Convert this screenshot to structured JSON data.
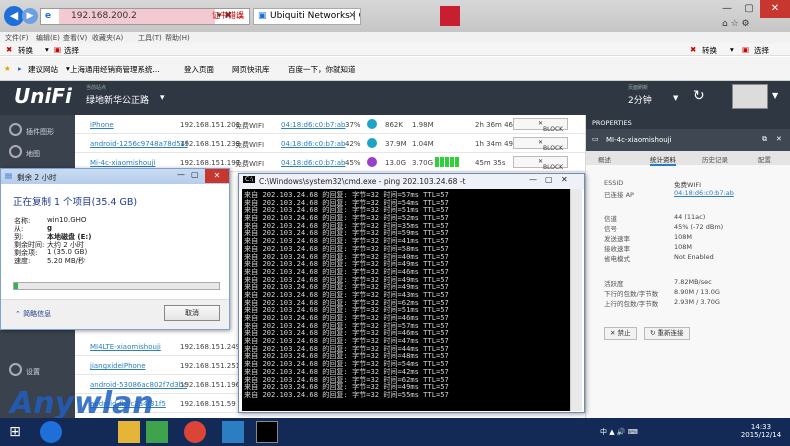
{
  "browser": {
    "address": "192.168.200.2",
    "tab_inactive": "证书错误",
    "tab_active": "Ubiquiti Networks | Clients",
    "menu": [
      "文件(F)",
      "编辑(E)",
      "查看(V)",
      "收藏夹(A)",
      "工具(T)",
      "帮助(H)"
    ],
    "cmd_left": [
      "转换",
      "选择"
    ],
    "cmd_right": [
      "转换",
      "选择"
    ],
    "favorites": [
      "建议网站",
      "上海通用经销商管理系统...",
      "登入页面",
      "网页快讯库",
      "百度一下，你就知道"
    ]
  },
  "unifi": {
    "logo": "UniFi",
    "site_label": "当前站点",
    "site_name": "绿地新华公正路",
    "refresh_label": "页面刷新",
    "refresh_value": "2分钟",
    "nav": [
      "插件图形",
      "地图",
      "设置"
    ]
  },
  "clients": [
    {
      "name": "iPhone",
      "ip": "192.168.151.201",
      "ap": "免费WIFI",
      "mac": "04:18:d6:c0:b7:ab",
      "pct": "37%",
      "down": "862K",
      "up": "1.98M",
      "uptime": "2h 36m 46s",
      "action": "BLOCK"
    },
    {
      "name": "android-1256c9748a78d54f",
      "ip": "192.168.151.239",
      "ap": "免费WIFI",
      "mac": "04:18:d6:c0:b7:ab",
      "pct": "42%",
      "down": "37.9M",
      "up": "1.04M",
      "uptime": "1h 34m 49s",
      "action": "BLOCK"
    },
    {
      "name": "Mi-4c-xiaomishouji",
      "ip": "192.168.151.197",
      "ap": "免费WIFI",
      "mac": "04:18:d6:c0:b7:ab",
      "pct": "45%",
      "down": "13.0G",
      "up": "3.70G",
      "uptime": "45m 35s",
      "action": "BLOCK"
    }
  ],
  "clients_lower": [
    {
      "name": "MI4LTE-xiaomishouji",
      "ip": "192.168.151.249"
    },
    {
      "name": "jiangxideiPhone",
      "ip": "192.168.151.251"
    },
    {
      "name": "android-53086ac802f7d3bc",
      "ip": "192.168.151.196"
    },
    {
      "name": "android-fb0c2a4f31f5",
      "ip": "192.168.151.59"
    }
  ],
  "properties": {
    "panel_title": "PROPERTIES",
    "device": "MI-4c-xiaomishouji",
    "tabs": [
      "概述",
      "统计资料",
      "历史记录",
      "配置"
    ],
    "essid_label": "ESSID",
    "essid": "免费WIFI",
    "ap_label": "已连接 AP",
    "ap": "04:18:d6:c0:b7:ab",
    "channel_label": "信道",
    "channel": "44 (11ac)",
    "signal_label": "信号",
    "signal": "45% (-72 dBm)",
    "tx_label": "发送速率",
    "tx": "108M",
    "rx_label": "接收速率",
    "rx": "108M",
    "power_label": "省电模式",
    "power": "Not Enabled",
    "activity_label": "活跃度",
    "activity": "7.82MB/sec",
    "dl_label": "下行的包数/字节数",
    "dl": "8.90M / 13.0G",
    "ul_label": "上行的包数/字节数",
    "ul": "2.93M / 3.70G",
    "btn_block": "禁止",
    "btn_reconnect": "重新连接"
  },
  "copy_dialog": {
    "titlebar": "剩余 2 小时",
    "heading": "正在复制 1 个项目(35.4 GB)",
    "name_label": "名称:",
    "name": "win10.GHO",
    "from_label": "从:",
    "from": "g",
    "to_label": "到:",
    "to": "本地磁盘 (E:)",
    "remain_time_label": "剩余时间:",
    "remain_time": "大约 2 小时",
    "remain_items_label": "剩余项:",
    "remain_items": "1 (35.0 GB)",
    "speed_label": "速度:",
    "speed": "5.20 MB/秒",
    "progress": 0.02,
    "less_info": "简略信息",
    "cancel": "取消"
  },
  "cmd": {
    "title": "C:\\Windows\\system32\\cmd.exe - ping  202.103.24.68 -t",
    "lines": [
      "来自 202.103.24.68 的回复: 字节=32 时间=57ms TTL=57",
      "来自 202.103.24.68 的回复: 字节=32 时间=54ms TTL=57",
      "来自 202.103.24.68 的回复: 字节=32 时间=51ms TTL=57",
      "来自 202.103.24.68 的回复: 字节=32 时间=52ms TTL=57",
      "来自 202.103.24.68 的回复: 字节=32 时间=35ms TTL=57",
      "来自 202.103.24.68 的回复: 字节=32 时间=59ms TTL=57",
      "来自 202.103.24.68 的回复: 字节=32 时间=41ms TTL=57",
      "来自 202.103.24.68 的回复: 字节=32 时间=58ms TTL=57",
      "来自 202.103.24.68 的回复: 字节=32 时间=40ms TTL=57",
      "来自 202.103.24.68 的回复: 字节=32 时间=49ms TTL=57",
      "来自 202.103.24.68 的回复: 字节=32 时间=46ms TTL=57",
      "来自 202.103.24.68 的回复: 字节=32 时间=49ms TTL=57",
      "来自 202.103.24.68 的回复: 字节=32 时间=49ms TTL=57",
      "来自 202.103.24.68 的回复: 字节=32 时间=43ms TTL=57",
      "来自 202.103.24.68 的回复: 字节=32 时间=62ms TTL=57",
      "来自 202.103.24.68 的回复: 字节=32 时间=51ms TTL=57",
      "来自 202.103.24.68 的回复: 字节=32 时间=46ms TTL=57",
      "来自 202.103.24.68 的回复: 字节=32 时间=57ms TTL=57",
      "来自 202.103.24.68 的回复: 字节=32 时间=46ms TTL=57",
      "来自 202.103.24.68 的回复: 字节=32 时间=47ms TTL=57",
      "来自 202.103.24.68 的回复: 字节=32 时间=44ms TTL=57",
      "来自 202.103.24.68 的回复: 字节=32 时间=48ms TTL=57",
      "来自 202.103.24.68 的回复: 字节=32 时间=54ms TTL=57",
      "来自 202.103.24.68 的回复: 字节=32 时间=42ms TTL=57",
      "来自 202.103.24.68 的回复: 字节=32 时间=62ms TTL=57",
      "来自 202.103.24.68 的回复: 字节=32 时间=49ms TTL=57",
      "来自 202.103.24.68 的回复: 字节=32 时间=55ms TTL=57"
    ]
  },
  "watermark": "Anywlan",
  "taskbar": {
    "tray_lang": "中 ▲ 🔊 ⌨",
    "time": "14:33",
    "date": "2015/12/14"
  }
}
